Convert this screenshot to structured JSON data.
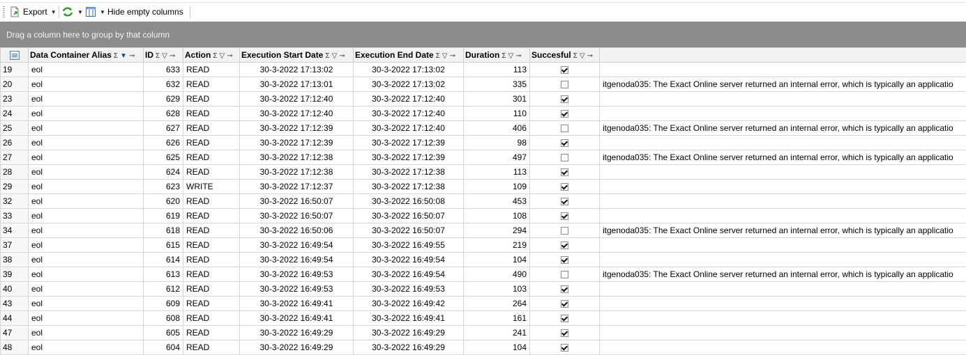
{
  "toolbar": {
    "export_label": "Export",
    "hide_empty_label": "Hide empty columns",
    "export_icon": "export-document-icon",
    "refresh_icon": "refresh-icon",
    "columns_icon": "column-chooser-icon"
  },
  "group_panel": {
    "text": "Drag a column here to group by that column"
  },
  "columns": [
    "Data Container Alias",
    "ID",
    "Action",
    "Execution Start Date",
    "Execution End Date",
    "Duration",
    "Succesful"
  ],
  "rows": [
    {
      "rn": "19",
      "alias": "eol",
      "id": "633",
      "action": "READ",
      "start": "30-3-2022 17:13:02",
      "end": "30-3-2022 17:13:02",
      "duration": "113",
      "ok": true,
      "message": ""
    },
    {
      "rn": "20",
      "alias": "eol",
      "id": "632",
      "action": "READ",
      "start": "30-3-2022 17:13:01",
      "end": "30-3-2022 17:13:02",
      "duration": "335",
      "ok": false,
      "message": "itgenoda035: The Exact Online server returned an internal error, which is typically an applicatio"
    },
    {
      "rn": "23",
      "alias": "eol",
      "id": "629",
      "action": "READ",
      "start": "30-3-2022 17:12:40",
      "end": "30-3-2022 17:12:40",
      "duration": "301",
      "ok": true,
      "message": ""
    },
    {
      "rn": "24",
      "alias": "eol",
      "id": "628",
      "action": "READ",
      "start": "30-3-2022 17:12:40",
      "end": "30-3-2022 17:12:40",
      "duration": "110",
      "ok": true,
      "message": ""
    },
    {
      "rn": "25",
      "alias": "eol",
      "id": "627",
      "action": "READ",
      "start": "30-3-2022 17:12:39",
      "end": "30-3-2022 17:12:40",
      "duration": "406",
      "ok": false,
      "message": "itgenoda035: The Exact Online server returned an internal error, which is typically an applicatio"
    },
    {
      "rn": "26",
      "alias": "eol",
      "id": "626",
      "action": "READ",
      "start": "30-3-2022 17:12:39",
      "end": "30-3-2022 17:12:39",
      "duration": "98",
      "ok": true,
      "message": ""
    },
    {
      "rn": "27",
      "alias": "eol",
      "id": "625",
      "action": "READ",
      "start": "30-3-2022 17:12:38",
      "end": "30-3-2022 17:12:39",
      "duration": "497",
      "ok": false,
      "message": "itgenoda035: The Exact Online server returned an internal error, which is typically an applicatio"
    },
    {
      "rn": "28",
      "alias": "eol",
      "id": "624",
      "action": "READ",
      "start": "30-3-2022 17:12:38",
      "end": "30-3-2022 17:12:38",
      "duration": "113",
      "ok": true,
      "message": ""
    },
    {
      "rn": "29",
      "alias": "eol",
      "id": "623",
      "action": "WRITE",
      "start": "30-3-2022 17:12:37",
      "end": "30-3-2022 17:12:38",
      "duration": "109",
      "ok": true,
      "message": ""
    },
    {
      "rn": "32",
      "alias": "eol",
      "id": "620",
      "action": "READ",
      "start": "30-3-2022 16:50:07",
      "end": "30-3-2022 16:50:08",
      "duration": "453",
      "ok": true,
      "message": ""
    },
    {
      "rn": "33",
      "alias": "eol",
      "id": "619",
      "action": "READ",
      "start": "30-3-2022 16:50:07",
      "end": "30-3-2022 16:50:07",
      "duration": "108",
      "ok": true,
      "message": ""
    },
    {
      "rn": "34",
      "alias": "eol",
      "id": "618",
      "action": "READ",
      "start": "30-3-2022 16:50:06",
      "end": "30-3-2022 16:50:07",
      "duration": "294",
      "ok": false,
      "message": "itgenoda035: The Exact Online server returned an internal error, which is typically an applicatio"
    },
    {
      "rn": "37",
      "alias": "eol",
      "id": "615",
      "action": "READ",
      "start": "30-3-2022 16:49:54",
      "end": "30-3-2022 16:49:55",
      "duration": "219",
      "ok": true,
      "message": ""
    },
    {
      "rn": "38",
      "alias": "eol",
      "id": "614",
      "action": "READ",
      "start": "30-3-2022 16:49:54",
      "end": "30-3-2022 16:49:54",
      "duration": "104",
      "ok": true,
      "message": ""
    },
    {
      "rn": "39",
      "alias": "eol",
      "id": "613",
      "action": "READ",
      "start": "30-3-2022 16:49:53",
      "end": "30-3-2022 16:49:54",
      "duration": "490",
      "ok": false,
      "message": "itgenoda035: The Exact Online server returned an internal error, which is typically an applicatio"
    },
    {
      "rn": "40",
      "alias": "eol",
      "id": "612",
      "action": "READ",
      "start": "30-3-2022 16:49:53",
      "end": "30-3-2022 16:49:53",
      "duration": "103",
      "ok": true,
      "message": ""
    },
    {
      "rn": "43",
      "alias": "eol",
      "id": "609",
      "action": "READ",
      "start": "30-3-2022 16:49:41",
      "end": "30-3-2022 16:49:42",
      "duration": "264",
      "ok": true,
      "message": ""
    },
    {
      "rn": "44",
      "alias": "eol",
      "id": "608",
      "action": "READ",
      "start": "30-3-2022 16:49:41",
      "end": "30-3-2022 16:49:41",
      "duration": "161",
      "ok": true,
      "message": ""
    },
    {
      "rn": "47",
      "alias": "eol",
      "id": "605",
      "action": "READ",
      "start": "30-3-2022 16:49:29",
      "end": "30-3-2022 16:49:29",
      "duration": "241",
      "ok": true,
      "message": ""
    },
    {
      "rn": "48",
      "alias": "eol",
      "id": "604",
      "action": "READ",
      "start": "30-3-2022 16:49:29",
      "end": "30-3-2022 16:49:29",
      "duration": "104",
      "ok": true,
      "message": ""
    }
  ]
}
